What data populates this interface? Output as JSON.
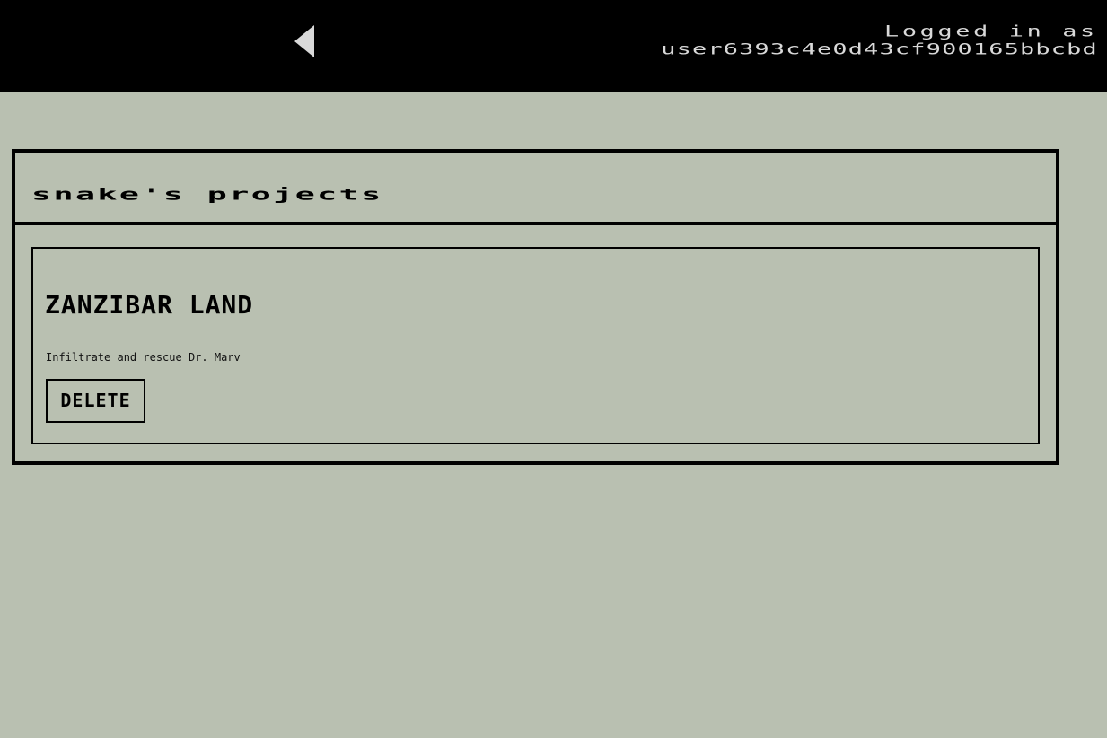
{
  "header": {
    "back_icon": "back-triangle-icon",
    "login_label": "Logged in as",
    "username": "user6393c4e0d43cf900165bbcbd"
  },
  "projects": {
    "title": "snake's projects",
    "items": [
      {
        "name": "ZANZIBAR LAND",
        "description": "Infiltrate and rescue Dr. Marv",
        "delete_label": "DELETE"
      }
    ]
  },
  "colors": {
    "background": "#b9c0b1",
    "header_bg": "#000000",
    "header_text": "#d9d9d9",
    "ink": "#000000"
  }
}
